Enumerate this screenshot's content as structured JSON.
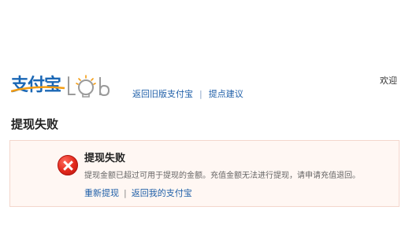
{
  "header": {
    "logo_text": "支付宝",
    "logo_lab": "Lab",
    "links": {
      "old_version": "返回旧版支付宝",
      "separator": "|",
      "feedback": "提点建议"
    },
    "welcome": "欢迎"
  },
  "page": {
    "title": "提现失败"
  },
  "notice": {
    "title": "提现失败",
    "message": "提现金额已超过可用于提现的金额。充值金额无法进行提现，请申请充值退回。",
    "links": {
      "retry": "重新提现",
      "separator": "|",
      "back": "返回我的支付宝"
    },
    "icon": "error-icon"
  },
  "colors": {
    "brand": "#1a67b5",
    "link": "#1f5fa8",
    "error": "#e2281b",
    "notice_bg": "#fff7f3",
    "notice_border": "#f4d6cc"
  }
}
